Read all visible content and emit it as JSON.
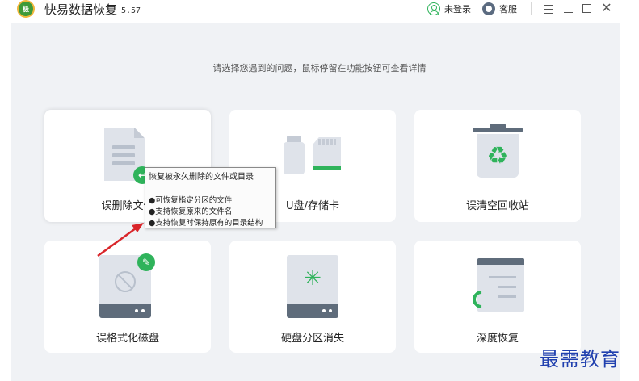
{
  "app": {
    "logo_text": "极",
    "title": "快易数据恢复",
    "version": "5.57"
  },
  "toolbar": {
    "login_label": "未登录",
    "service_label": "客服",
    "close_glyph": "✕"
  },
  "main": {
    "hint": "请选择您遇到的问题，鼠标停留在功能按钮可查看详情",
    "cards": [
      {
        "label": "误删除文件",
        "icon": "document-restore-icon"
      },
      {
        "label": "U盘/存储卡",
        "icon": "usb-sdcard-icon"
      },
      {
        "label": "误清空回收站",
        "icon": "recycle-bin-icon"
      },
      {
        "label": "误格式化磁盘",
        "icon": "formatted-disk-icon"
      },
      {
        "label": "硬盘分区消失",
        "icon": "disk-partition-icon"
      },
      {
        "label": "深度恢复",
        "icon": "deep-recover-icon"
      }
    ]
  },
  "tooltip": {
    "title": "恢复被永久删除的文件或目录",
    "items": [
      "●可恢复指定分区的文件",
      "●支持恢复原来的文件名",
      "●支持恢复时保持原有的目录结构"
    ]
  },
  "card_badges": {
    "undo_glyph": "↩",
    "broom_glyph": "✎",
    "recycle_glyph": "♻",
    "spinner_glyph": "✳"
  },
  "watermark": "最需教育",
  "colors": {
    "accent_green": "#2fb35b",
    "panel_bg": "#f0f2f5",
    "icon_gray": "#dfe3ea",
    "icon_dark": "#5f6c7b",
    "annotation_red": "#d9252a",
    "watermark_blue": "#1f3fae"
  }
}
